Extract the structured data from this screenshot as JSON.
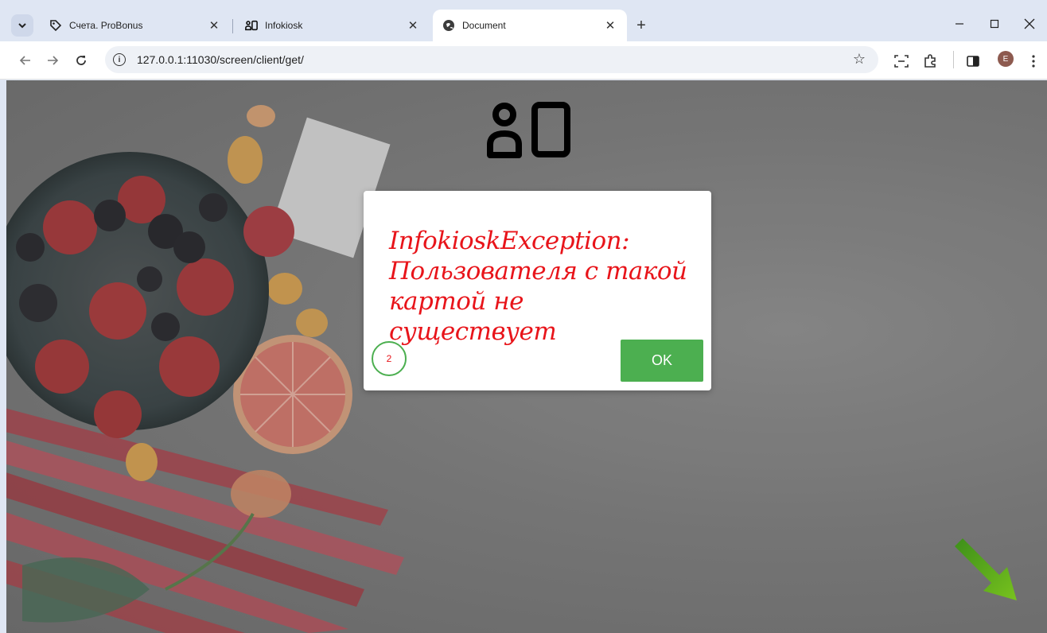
{
  "browser": {
    "tabs": [
      {
        "title": "Счета. ProBonus",
        "favicon": "tag-icon",
        "active": false
      },
      {
        "title": "Infokiosk",
        "favicon": "kiosk-icon",
        "active": false
      },
      {
        "title": "Document",
        "favicon": "globe-icon",
        "active": true
      }
    ],
    "address_bar": {
      "url": "127.0.0.1:11030/screen/client/get/"
    },
    "profile_initial": "E"
  },
  "page": {
    "logo_icon": "person-card-icon",
    "dialog": {
      "message": "InfokioskException: Пользователя с такой картой не существует",
      "countdown": "2",
      "ok_label": "OK"
    },
    "hint_arrow_icon": "arrow-down-right-icon"
  },
  "colors": {
    "error_text": "#e8141a",
    "button_green": "#4caf50",
    "tab_strip": "#dfe6f3"
  }
}
